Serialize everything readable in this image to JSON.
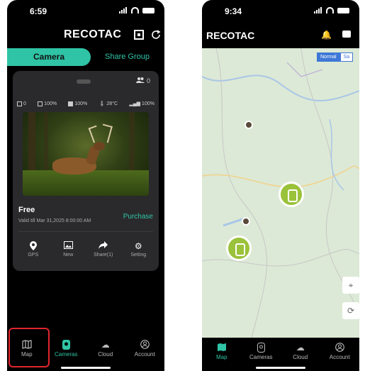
{
  "phone1": {
    "status": {
      "time": "6:59"
    },
    "header": {
      "brand": "RECOTAC"
    },
    "tabs": {
      "camera": "Camera",
      "share_group": "Share Group"
    },
    "card": {
      "share_count": "0",
      "stats": {
        "photos": "0",
        "sd_card": "100%",
        "battery": "100%",
        "temperature": "28°C",
        "signal": "100%"
      },
      "plan": "Free",
      "valid": "Valid till Mar 31,2025 8:00:00 AM",
      "purchase": "Purchase",
      "actions": [
        {
          "label": "GPS",
          "icon": "pin-icon"
        },
        {
          "label": "New",
          "icon": "photo-icon"
        },
        {
          "label": "Share(1)",
          "icon": "share-icon"
        },
        {
          "label": "Setting",
          "icon": "gear-icon"
        }
      ]
    },
    "nav": [
      {
        "label": "Map",
        "icon": "map-icon"
      },
      {
        "label": "Cameras",
        "icon": "camera-icon"
      },
      {
        "label": "Cloud",
        "icon": "cloud-icon"
      },
      {
        "label": "Account",
        "icon": "account-icon"
      }
    ]
  },
  "phone2": {
    "status": {
      "time": "9:34"
    },
    "header": {
      "brand": "RECOTAC"
    },
    "map_types": {
      "normal": "Normal",
      "satellite": "Sa"
    },
    "nav": [
      {
        "label": "Map",
        "icon": "map-icon"
      },
      {
        "label": "Cameras",
        "icon": "camera-icon"
      },
      {
        "label": "Cloud",
        "icon": "cloud-icon"
      },
      {
        "label": "Account",
        "icon": "account-icon"
      }
    ]
  },
  "colors": {
    "accent": "#2fc4a5",
    "highlight": "#e0262d",
    "map_pin": "#9ac23a"
  }
}
